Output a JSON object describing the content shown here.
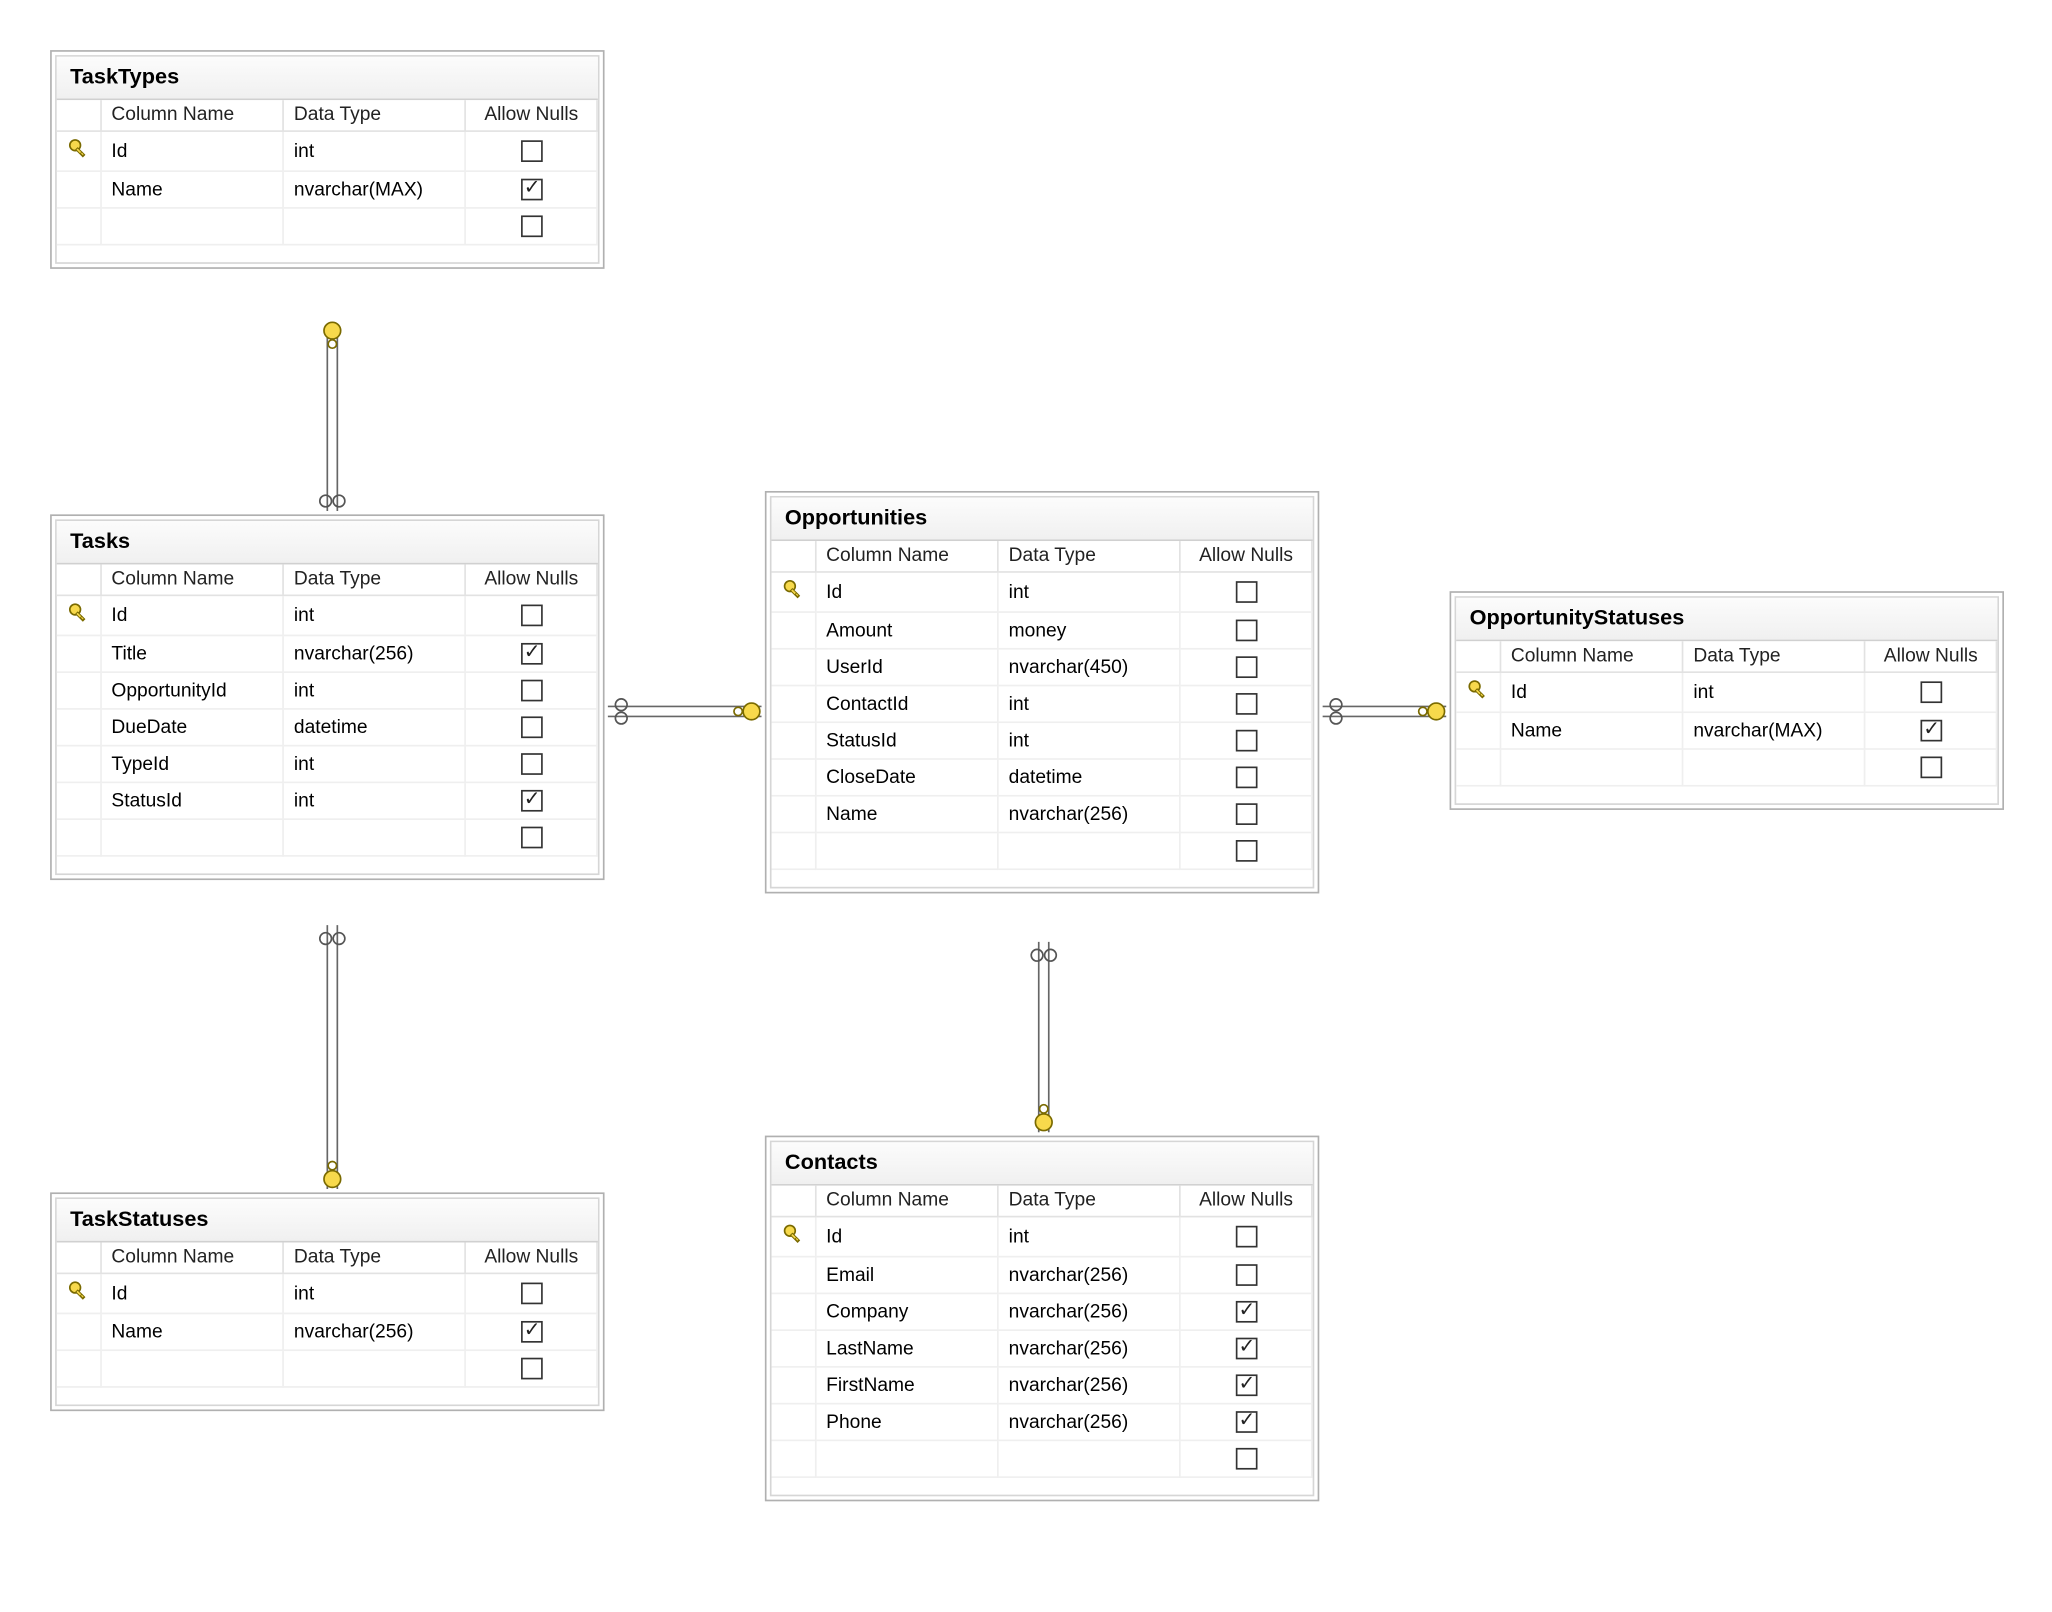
{
  "headers": {
    "col": "Column Name",
    "type": "Data Type",
    "nulls": "Allow Nulls"
  },
  "tables": {
    "taskTypes": {
      "title": "TaskTypes",
      "rows": [
        {
          "pk": true,
          "name": "Id",
          "type": "int",
          "nulls": false
        },
        {
          "pk": false,
          "name": "Name",
          "type": "nvarchar(MAX)",
          "nulls": true
        }
      ]
    },
    "tasks": {
      "title": "Tasks",
      "rows": [
        {
          "pk": true,
          "name": "Id",
          "type": "int",
          "nulls": false
        },
        {
          "pk": false,
          "name": "Title",
          "type": "nvarchar(256)",
          "nulls": true
        },
        {
          "pk": false,
          "name": "OpportunityId",
          "type": "int",
          "nulls": false
        },
        {
          "pk": false,
          "name": "DueDate",
          "type": "datetime",
          "nulls": false
        },
        {
          "pk": false,
          "name": "TypeId",
          "type": "int",
          "nulls": false
        },
        {
          "pk": false,
          "name": "StatusId",
          "type": "int",
          "nulls": true
        }
      ]
    },
    "taskStatuses": {
      "title": "TaskStatuses",
      "rows": [
        {
          "pk": true,
          "name": "Id",
          "type": "int",
          "nulls": false
        },
        {
          "pk": false,
          "name": "Name",
          "type": "nvarchar(256)",
          "nulls": true
        }
      ]
    },
    "opportunities": {
      "title": "Opportunities",
      "rows": [
        {
          "pk": true,
          "name": "Id",
          "type": "int",
          "nulls": false
        },
        {
          "pk": false,
          "name": "Amount",
          "type": "money",
          "nulls": false
        },
        {
          "pk": false,
          "name": "UserId",
          "type": "nvarchar(450)",
          "nulls": false
        },
        {
          "pk": false,
          "name": "ContactId",
          "type": "int",
          "nulls": false
        },
        {
          "pk": false,
          "name": "StatusId",
          "type": "int",
          "nulls": false
        },
        {
          "pk": false,
          "name": "CloseDate",
          "type": "datetime",
          "nulls": false
        },
        {
          "pk": false,
          "name": "Name",
          "type": "nvarchar(256)",
          "nulls": false
        }
      ]
    },
    "opportunityStatuses": {
      "title": "OpportunityStatuses",
      "rows": [
        {
          "pk": true,
          "name": "Id",
          "type": "int",
          "nulls": false
        },
        {
          "pk": false,
          "name": "Name",
          "type": "nvarchar(MAX)",
          "nulls": true
        }
      ]
    },
    "contacts": {
      "title": "Contacts",
      "rows": [
        {
          "pk": true,
          "name": "Id",
          "type": "int",
          "nulls": false
        },
        {
          "pk": false,
          "name": "Email",
          "type": "nvarchar(256)",
          "nulls": false
        },
        {
          "pk": false,
          "name": "Company",
          "type": "nvarchar(256)",
          "nulls": true
        },
        {
          "pk": false,
          "name": "LastName",
          "type": "nvarchar(256)",
          "nulls": true
        },
        {
          "pk": false,
          "name": "FirstName",
          "type": "nvarchar(256)",
          "nulls": true
        },
        {
          "pk": false,
          "name": "Phone",
          "type": "nvarchar(256)",
          "nulls": true
        }
      ]
    }
  },
  "relationships": [
    {
      "from": "tasks",
      "to": "taskTypes",
      "fromEnd": "many",
      "toEnd": "one"
    },
    {
      "from": "tasks",
      "to": "taskStatuses",
      "fromEnd": "many",
      "toEnd": "one"
    },
    {
      "from": "tasks",
      "to": "opportunities",
      "fromEnd": "many",
      "toEnd": "one"
    },
    {
      "from": "opportunities",
      "to": "opportunityStatuses",
      "fromEnd": "many",
      "toEnd": "one"
    },
    {
      "from": "opportunities",
      "to": "contacts",
      "fromEnd": "many",
      "toEnd": "one"
    }
  ]
}
